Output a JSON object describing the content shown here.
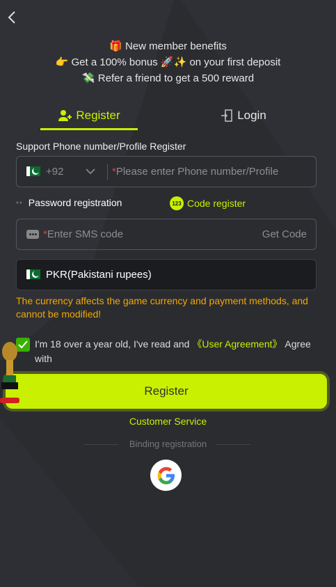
{
  "header": {
    "back_icon": "chevron-left-icon"
  },
  "benefits": {
    "line1": "🎁 New member benefits",
    "line2": "👉 Get a 100% bonus 🚀✨ on your first deposit",
    "line3": "💸 Refer a friend to get a 500 reward"
  },
  "tabs": {
    "register": "Register",
    "login": "Login"
  },
  "form": {
    "section_title": "Support Phone number/Profile Register",
    "country_code": "+92",
    "phone_placeholder": "Please enter Phone number/Profile",
    "required_mark": "*",
    "password_option": "Password registration",
    "code_option": "Code register",
    "code_badge": "123",
    "sms_placeholder": "Enter SMS code",
    "get_code": "Get Code",
    "currency": "PKR(Pakistani rupees)",
    "currency_warning": "The currency affects the game currency and payment methods, and cannot be modified!",
    "agree_prefix": "I'm 18 over a year old, I've read and ",
    "agree_link": "《User Agreement》",
    "agree_suffix": " Agree with",
    "agree_checked": true,
    "register_button": "Register"
  },
  "footer": {
    "customer_service": "Customer Service",
    "binding": "Binding registration"
  },
  "colors": {
    "accent": "#c8f000",
    "warning": "#f2a800",
    "background": "#2b2c30"
  }
}
